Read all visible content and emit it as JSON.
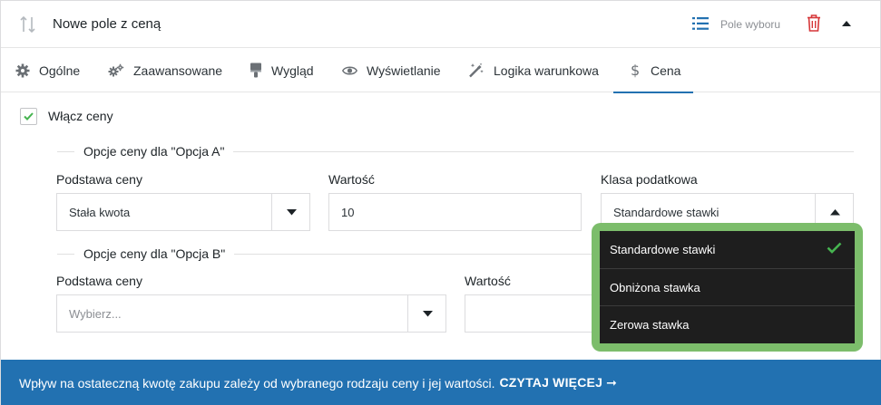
{
  "header": {
    "title": "Nowe pole z ceną",
    "field_type": "Pole wyboru"
  },
  "tabs": [
    {
      "label": "Ogólne",
      "icon": "gear-icon"
    },
    {
      "label": "Zaawansowane",
      "icon": "gears-icon"
    },
    {
      "label": "Wygląd",
      "icon": "paint-brush-icon"
    },
    {
      "label": "Wyświetlanie",
      "icon": "eye-icon"
    },
    {
      "label": "Logika warunkowa",
      "icon": "magic-wand-icon"
    },
    {
      "label": "Cena",
      "icon": "dollar-icon",
      "active": true
    }
  ],
  "enable_prices": {
    "label": "Włącz ceny",
    "checked": true
  },
  "option_a": {
    "legend": "Opcje ceny dla \"Opcja A\"",
    "base_label": "Podstawa ceny",
    "base_value": "Stała kwota",
    "value_label": "Wartość",
    "value": "10",
    "tax_label": "Klasa podatkowa",
    "tax_value": "Standardowe stawki"
  },
  "option_b": {
    "legend": "Opcje ceny dla \"Opcja B\"",
    "base_label": "Podstawa ceny",
    "base_placeholder": "Wybierz...",
    "value_label": "Wartość"
  },
  "tax_dropdown": {
    "options": [
      "Standardowe stawki",
      "Obniżona stawka",
      "Zerowa stawka"
    ],
    "selected_index": 0
  },
  "footer": {
    "text": "Wpływ na ostateczną kwotę zakupu zależy od wybranego rodzaju ceny i jej wartości.",
    "link": "CZYTAJ WIĘCEJ ➞"
  },
  "colors": {
    "accent": "#2271b1",
    "check_green": "#46b450",
    "delete_red": "#d63638",
    "highlight_green": "#7cbd6b",
    "dropdown_bg": "#1e1e1e"
  }
}
